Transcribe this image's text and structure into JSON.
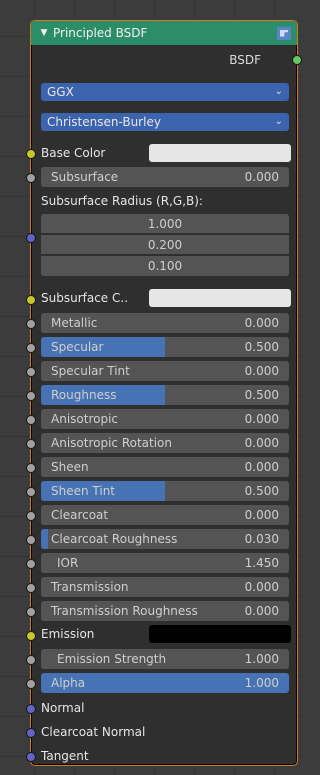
{
  "node": {
    "title": "Principled BSDF",
    "output_label": "BSDF",
    "distribution": "GGX",
    "subsurface_method": "Christensen-Burley",
    "base_color_label": "Base Color",
    "subsurface_label": "Subsurface",
    "subsurface_value": "0.000",
    "subsurface_radius_label": "Subsurface Radius (R,G,B):",
    "subsurface_radius": [
      "1.000",
      "0.200",
      "0.100"
    ],
    "subsurface_color_label": "Subsurface C..",
    "params": [
      {
        "label": "Metallic",
        "value": "0.000",
        "fill": 0.0
      },
      {
        "label": "Specular",
        "value": "0.500",
        "fill": 0.5
      },
      {
        "label": "Specular Tint",
        "value": "0.000",
        "fill": 0.0
      },
      {
        "label": "Roughness",
        "value": "0.500",
        "fill": 0.5
      },
      {
        "label": "Anisotropic",
        "value": "0.000",
        "fill": 0.0
      },
      {
        "label": "Anisotropic Rotation",
        "value": "0.000",
        "fill": 0.0
      },
      {
        "label": "Sheen",
        "value": "0.000",
        "fill": 0.0
      },
      {
        "label": "Sheen Tint",
        "value": "0.500",
        "fill": 0.5
      },
      {
        "label": "Clearcoat",
        "value": "0.000",
        "fill": 0.0
      },
      {
        "label": "Clearcoat Roughness",
        "value": "0.030",
        "fill": 0.03
      },
      {
        "label": "IOR",
        "value": "1.450",
        "fill": 0.0
      },
      {
        "label": "Transmission",
        "value": "0.000",
        "fill": 0.0
      },
      {
        "label": "Transmission Roughness",
        "value": "0.000",
        "fill": 0.0
      }
    ],
    "emission_label": "Emission",
    "emission_strength_label": "Emission Strength",
    "emission_strength_value": "1.000",
    "alpha_label": "Alpha",
    "alpha_value": "1.000",
    "alpha_fill": 1.0,
    "normal_label": "Normal",
    "clearcoat_normal_label": "Clearcoat Normal",
    "tangent_label": "Tangent"
  },
  "colors": {
    "header": "#2c8d6a",
    "border": "#d77a18",
    "dropdown": "#3c63ad",
    "field": "#545454",
    "fill": "#4772b3",
    "socket_color": "#c7c729",
    "socket_float": "#a1a1a1",
    "socket_vector": "#6363c7",
    "socket_shader": "#63c763",
    "base_color_swatch": "#e6e6e6",
    "subsurface_color_swatch": "#e6e6e6",
    "emission_swatch": "#000000"
  }
}
